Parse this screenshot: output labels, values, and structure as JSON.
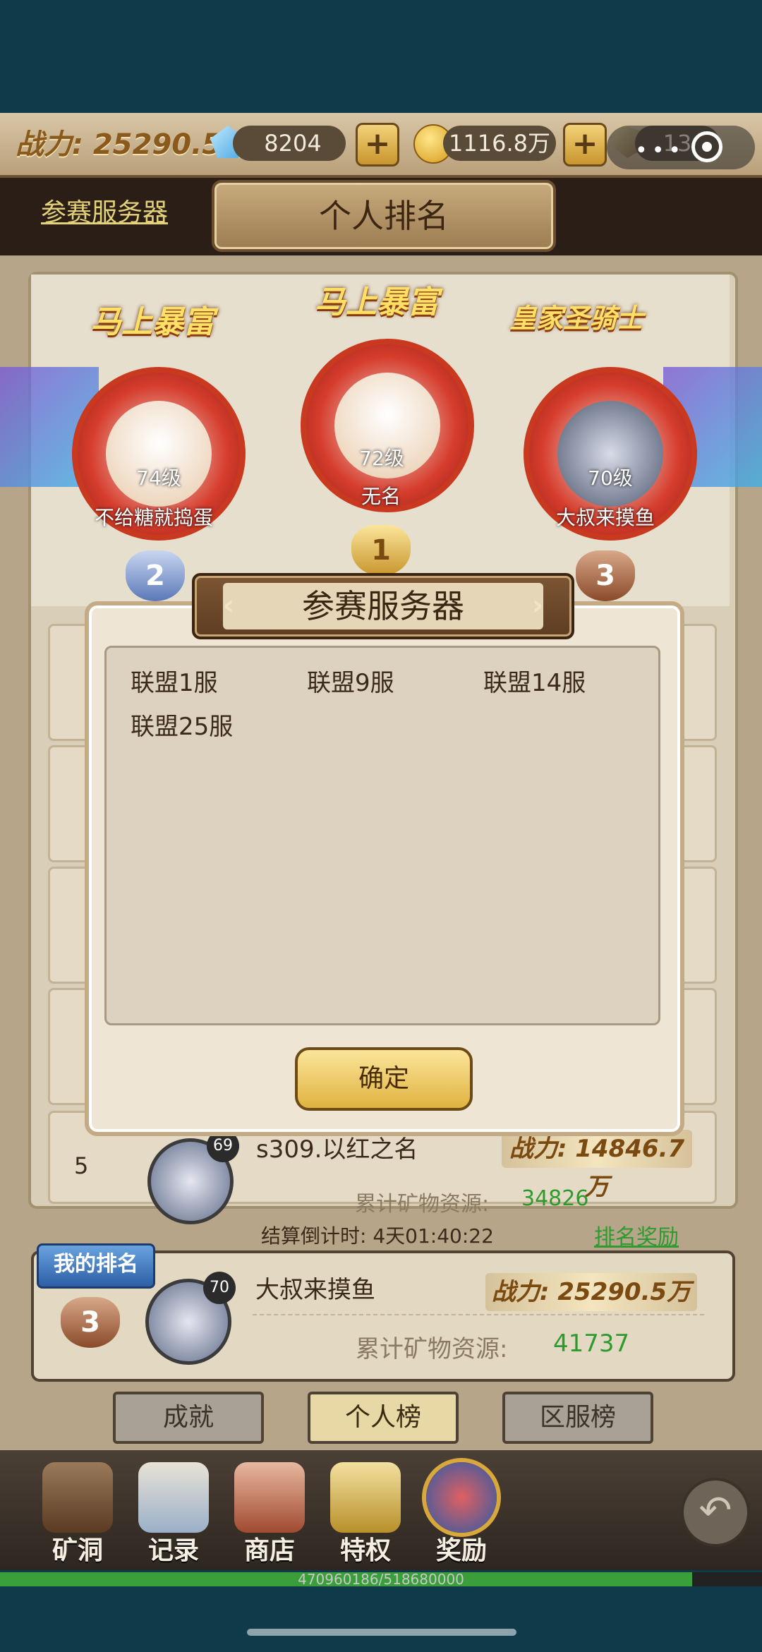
{
  "topbar": {
    "power_text": "战力: 25290.5万",
    "diamonds": "8204",
    "gold": "1116.8万",
    "ore": "13"
  },
  "header": {
    "server_link": "参赛服务器",
    "title": "个人排名"
  },
  "podium": {
    "first": {
      "title": "马上暴富",
      "level": "72级",
      "name": "无名",
      "rank": "1"
    },
    "second": {
      "title": "马上暴富",
      "level": "74级",
      "name": "不给糖就捣蛋",
      "rank": "2"
    },
    "third": {
      "title": "皇家圣骑士",
      "level": "70级",
      "name": "大叔来摸鱼",
      "rank": "3"
    }
  },
  "list": {
    "row5": {
      "rank": "5",
      "level": "69",
      "name": "s309.以红之名",
      "power": "战力: 14846.7万",
      "ore_label": "累计矿物资源:",
      "ore_value": "34826"
    }
  },
  "footer": {
    "countdown_label": "结算倒计时:",
    "countdown_value": "4天01:40:22",
    "rank_reward": "排名奖励"
  },
  "my_rank": {
    "tag": "我的排名",
    "rank": "3",
    "level": "70",
    "name": "大叔来摸鱼",
    "power": "战力: 25290.5万",
    "ore_label": "累计矿物资源:",
    "ore_value": "41737"
  },
  "tabs": [
    "成就",
    "个人榜",
    "区服榜"
  ],
  "bottom_nav": [
    "矿洞",
    "记录",
    "商店",
    "特权",
    "奖励"
  ],
  "exp": {
    "text": "470960186/518680000",
    "progress": 0.908
  },
  "modal": {
    "title": "参赛服务器",
    "servers": [
      "联盟1服",
      "联盟9服",
      "联盟14服",
      "联盟25服"
    ],
    "ok_button": "确定"
  },
  "icons": {
    "diamond": "diamond-icon",
    "gold": "gold-coin-icon",
    "ore": "ore-icon",
    "add": "plus-icon",
    "back": "back-arrow-icon"
  }
}
